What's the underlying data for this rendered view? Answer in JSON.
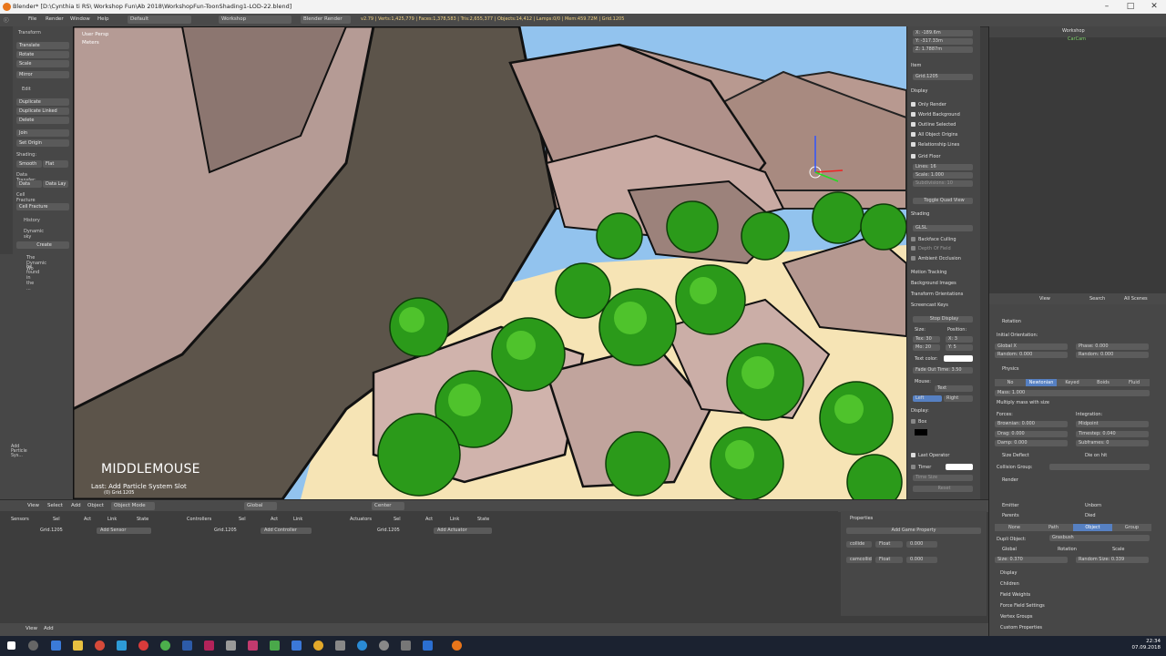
{
  "window": {
    "title": "Blender* [D:\\Cynthia ti RS\\ Workshop Fun\\Ab 2018\\WorkshopFun-ToonShading1-LOD-22.blend]"
  },
  "info_header": {
    "menus": [
      "File",
      "Render",
      "Window",
      "Help"
    ],
    "layout": "Default",
    "scene": "Workshop",
    "engine": "Blender Render",
    "stats": "v2.79 | Verts:1,425,779 | Faces:1,378,583 | Tris:2,655,377 | Objects:14,412 | Lamps:0/0 | Mem:459.72M | Grid.1205"
  },
  "tool_shelf": {
    "transform_header": "Transform",
    "transform_buttons": [
      "Translate",
      "Rotate",
      "Scale",
      "Mirror"
    ],
    "edit_header": "Edit",
    "edit_buttons": [
      "Duplicate",
      "Duplicate Linked",
      "Delete",
      "Join",
      "Set Origin"
    ],
    "shading_label": "Shading:",
    "smooth": "Smooth",
    "flat": "Flat",
    "data_transfer_label": "Data Transfer:",
    "data": "Data",
    "data_lay": "Data Lay",
    "cell_fracture_label": "Cell Fracture",
    "cell_fracture_btn": "Cell Fracture",
    "history": "History",
    "dynamic_sky": "Dynamic sky",
    "create": "Create",
    "sky_note_1": "The Dynamic Wo",
    "sky_note_2": "be found in the ...",
    "last_op_panel": "Add Particle Sys..."
  },
  "viewport": {
    "view_label": "User Persp",
    "units_label": "Meters",
    "key_overlay": "MIDDLEMOUSE",
    "last_operator": "Last: Add Particle System Slot",
    "object_info": "(0) Grid.1205"
  },
  "n_panel": {
    "x": "X:  -189.6m",
    "y": "Y:  -317.33m",
    "z": "Z:  1.7887m",
    "item_header": "Item",
    "item_name": "Grid.1205",
    "display_header": "Display",
    "checks": [
      "Only Render",
      "World Background",
      "Outline Selected",
      "All Object Origins",
      "Relationship Lines",
      "Grid Floor"
    ],
    "lines": "Lines:  16",
    "scale": "Scale:  1.000",
    "subdivisions": "Subdivisions: 10",
    "toggle_quad": "Toggle Quad View",
    "shading_header": "Shading",
    "glsl": "GLSL",
    "backface": "Backface Culling",
    "depth_of_field": "Depth Of Field",
    "ambient_occlusion": "Ambient Occlusion",
    "motion_tracking": "Motion Tracking",
    "background_images": "Background Images",
    "transform_orientations": "Transform Orientations",
    "screencast_keys": "Screencast Keys",
    "stop_display": "Stop Display",
    "size_label": "Size:",
    "position_label": "Position:",
    "text_30": "Tex: 30",
    "mo_20": "Mo: 20",
    "x3": "X: 3",
    "y5": "Y: 5",
    "text_color": "Text color:",
    "fade_out": "Fade Out Time:  3.50",
    "mouse_label": "Mouse:",
    "mouse_value": "Text",
    "left": "Left",
    "right": "Right",
    "display_label": "Display:",
    "box": "Box",
    "last_operator": "Last Operator",
    "timer": "Timer",
    "time_size": "Time Size",
    "reset": "Reset"
  },
  "outliner": {
    "scene": "Workshop",
    "object": "CarCam"
  },
  "properties": {
    "header_items": [
      "View",
      "Search",
      "All Scenes"
    ],
    "rotation_header": "Rotation",
    "initial_orientation": "Initial Orientation:",
    "global_x": "Global X",
    "phase": "Phase:  0.000",
    "random_l": "Random:  0.000",
    "random_r": "Random:  0.000",
    "physics_header": "Physics",
    "physics_types": [
      "No",
      "Newtonian",
      "Keyed",
      "Boids",
      "Fluid"
    ],
    "mass": "Mass:  1.000",
    "multiply_mass": "Multiply mass with size",
    "forces": "Forces:",
    "integration": "Integration:",
    "brownian": "Brownian:  0.000",
    "midpoint": "Midpoint",
    "drag": "Drag:  0.000",
    "timestep": "Timestep:  0.040",
    "damp": "Damp:  0.000",
    "subframes": "Subframes:  0",
    "size_deflect": "Size Deflect",
    "die_on_hit": "Die on hit",
    "collision_group": "Collision Group:",
    "render_header": "Render",
    "emitter": "Emitter",
    "unborn": "Unborn",
    "parents": "Parents",
    "died": "Died",
    "render_types": [
      "None",
      "Path",
      "Object",
      "Group"
    ],
    "dupli_object": "Dupli Object:",
    "dupli_value": "Grasbush",
    "global": "Global",
    "rotation": "Rotation",
    "scale": "Scale",
    "size": "Size:  0.370",
    "random_size": "Random Size:  0.339",
    "collapsed": [
      "Display",
      "Children",
      "Field Weights",
      "Force Field Settings",
      "Vertex Groups",
      "Custom Properties"
    ]
  },
  "view3d_header": {
    "menus": [
      "View",
      "Select",
      "Add",
      "Object"
    ],
    "mode": "Object Mode",
    "orientation": "Global",
    "pivot": "Center"
  },
  "logic_editor": {
    "sensors": "Sensors",
    "controllers": "Controllers",
    "actuators": "Actuators",
    "sel": "Sel",
    "act": "Act",
    "link": "Link",
    "state": "State",
    "grid": "Grid.1205",
    "add_sensor": "Add Sensor",
    "add_controller": "Add Controller",
    "add_actuator": "Add Actuator",
    "properties_header": "Properties",
    "add_game_property": "Add Game Property",
    "prop1_name": "collide",
    "prop1_type": "Float",
    "prop1_value": "0.000",
    "prop2_name": "camcollid",
    "prop2_type": "Float",
    "prop2_value": "0.000",
    "footer_menus": [
      "View",
      "Add"
    ]
  },
  "taskbar": {
    "time": "22:34",
    "date": "07.09.2018"
  }
}
